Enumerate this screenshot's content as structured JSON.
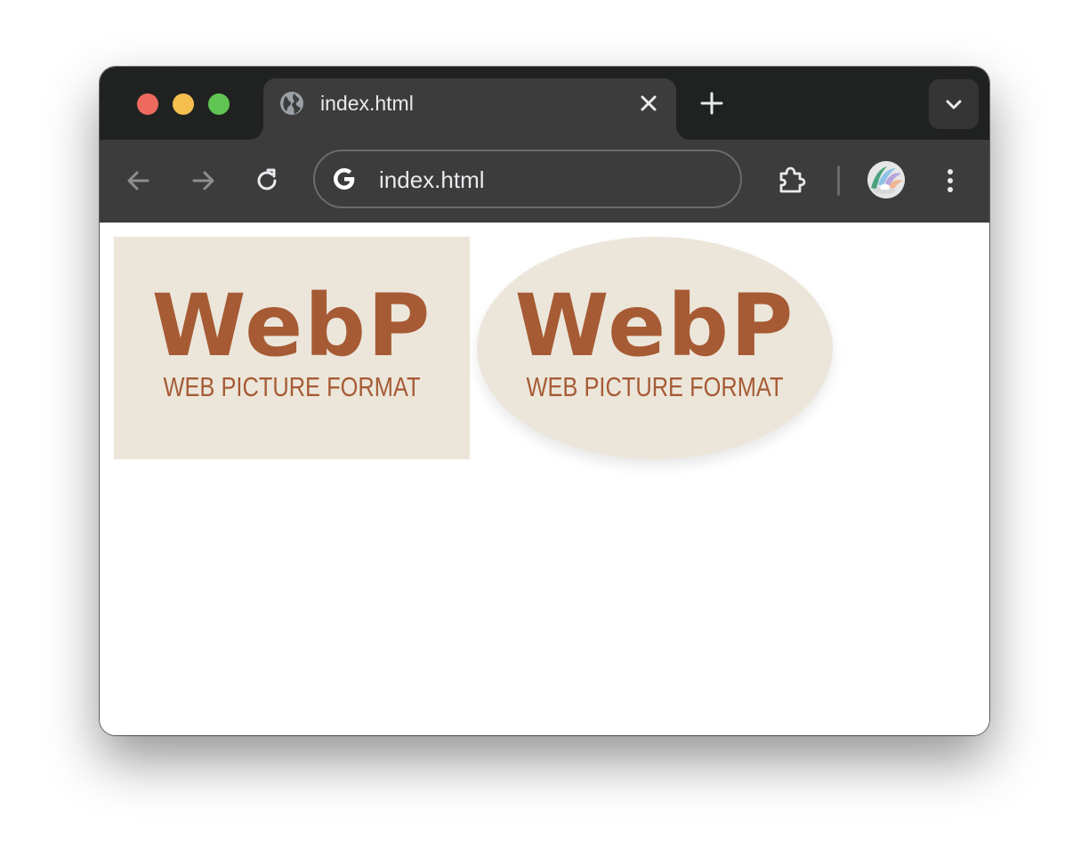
{
  "window": {
    "tab_title": "index.html",
    "address": "index.html"
  },
  "icons": {
    "tab_favicon": "globe-icon",
    "tab_close": "close-icon",
    "new_tab": "plus-icon",
    "tab_search": "chevron-down-icon",
    "back": "arrow-left-icon",
    "forward": "arrow-right-icon",
    "reload": "reload-icon",
    "site_info": "google-g-icon",
    "extensions": "puzzle-icon",
    "menu": "kebab-menu-icon"
  },
  "content": {
    "images": [
      {
        "shape": "rectangle",
        "title": "WebP",
        "subtitle": "WEB PICTURE FORMAT"
      },
      {
        "shape": "ellipse",
        "title": "WebP",
        "subtitle": "WEB PICTURE FORMAT"
      }
    ]
  },
  "colors": {
    "tabstrip": "#202222",
    "toolbar": "#3c3c3c",
    "logo_background": "#ece6da",
    "logo_text": "#a65b35"
  }
}
